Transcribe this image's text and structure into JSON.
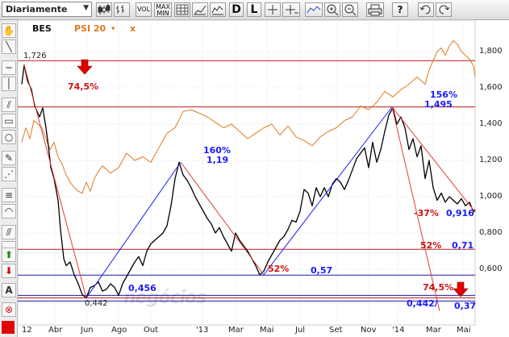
{
  "toolbar": {
    "period": "Diariamente",
    "buttons": [
      "candlestick-icon",
      "bars-icon",
      "line-chart-icon",
      "mountain-icon",
      "VOL",
      "MAX MIN",
      "grid-icon",
      "log-scale-icon",
      "percent-icon",
      "D",
      "L",
      "crosshair-icon",
      "horizontal-line-icon",
      "trend-tool-icon",
      "zoom-in-icon",
      "zoom-out-icon",
      "print-icon",
      "help-icon",
      "undo-icon",
      "redo-icon"
    ],
    "vol_label": "VOL",
    "maxmin_label_top": "MAX",
    "maxmin_label_bottom": "MIN",
    "d_label": "D",
    "l_label": "L",
    "help_label": "?"
  },
  "legend": {
    "main": "BES",
    "compare": "PSI 20",
    "compare_arrow": "▾",
    "close": "x"
  },
  "watermark": "negócios",
  "colors": {
    "bes": "#000000",
    "psi": "#e07a1e",
    "trend_up": "#1a1aff",
    "trend_down": "#e23b3b",
    "level": "#b81c1c",
    "level_blue": "#1a1a9e"
  },
  "chart_data": {
    "type": "line",
    "x_labels": [
      "12",
      "Abr",
      "Jun",
      "Ago",
      "Out",
      "'13",
      "Mar",
      "Mai",
      "Jul",
      "Set",
      "Nov",
      "'14",
      "Mar",
      "Mai"
    ],
    "y_ticks": [
      "1,800",
      "1,600",
      "1,400",
      "1,200",
      "1,000",
      "0,800",
      "0,600"
    ],
    "ylim": [
      0.35,
      1.9
    ],
    "series": [
      {
        "name": "BES",
        "x": [
          0,
          3,
          7,
          12,
          16,
          22,
          26,
          30,
          33,
          36,
          40,
          45,
          48,
          52,
          55,
          60,
          65,
          70,
          75,
          80,
          85,
          90,
          95,
          100,
          105,
          110,
          115,
          120,
          125,
          130,
          135,
          140,
          145,
          150,
          155,
          160,
          165,
          170,
          175,
          180,
          185,
          190,
          195,
          200,
          205,
          210,
          215,
          220,
          225,
          230,
          235,
          240,
          245,
          250,
          255,
          260,
          265,
          270,
          275,
          280,
          285,
          290,
          295,
          300,
          305,
          310,
          315,
          320,
          325,
          330,
          335,
          340,
          345,
          350,
          355,
          360,
          365,
          370,
          375,
          380,
          385,
          390,
          395,
          400,
          405,
          410,
          415,
          420,
          425,
          430,
          435,
          440,
          445,
          450,
          455,
          460,
          465,
          470,
          475,
          480,
          485,
          490,
          495,
          500,
          505,
          510,
          515,
          520,
          525,
          530,
          535,
          540,
          545,
          550,
          555,
          560,
          562
        ],
        "y": [
          1.62,
          1.726,
          1.64,
          1.59,
          1.5,
          1.44,
          1.49,
          1.38,
          1.28,
          1.16,
          1.1,
          0.98,
          0.82,
          0.66,
          0.62,
          0.64,
          0.57,
          0.52,
          0.46,
          0.442,
          0.5,
          0.51,
          0.53,
          0.48,
          0.49,
          0.52,
          0.5,
          0.456,
          0.52,
          0.56,
          0.6,
          0.64,
          0.67,
          0.62,
          0.7,
          0.74,
          0.76,
          0.78,
          0.8,
          0.84,
          0.95,
          1.1,
          1.19,
          1.12,
          1.09,
          1.05,
          1.0,
          0.96,
          0.92,
          0.88,
          0.85,
          0.8,
          0.83,
          0.78,
          0.74,
          0.7,
          0.8,
          0.76,
          0.73,
          0.7,
          0.66,
          0.62,
          0.57,
          0.59,
          0.64,
          0.68,
          0.72,
          0.76,
          0.78,
          0.82,
          0.87,
          0.86,
          0.92,
          1.04,
          1.02,
          0.95,
          1.05,
          1.0,
          1.05,
          1.0,
          1.07,
          1.1,
          1.08,
          1.04,
          1.09,
          1.15,
          1.21,
          1.24,
          1.27,
          1.16,
          1.3,
          1.19,
          1.26,
          1.36,
          1.45,
          1.49,
          1.4,
          1.44,
          1.38,
          1.26,
          1.32,
          1.22,
          1.28,
          1.1,
          1.2,
          1.05,
          0.98,
          1.02,
          0.97,
          1.0,
          0.98,
          0.96,
          0.99,
          0.95,
          0.97,
          0.916,
          0.93
        ]
      },
      {
        "name": "PSI 20",
        "x": [
          0,
          5,
          10,
          15,
          20,
          25,
          30,
          35,
          40,
          45,
          50,
          55,
          60,
          65,
          70,
          75,
          80,
          85,
          90,
          95,
          100,
          110,
          120,
          130,
          140,
          150,
          160,
          170,
          180,
          190,
          200,
          210,
          220,
          230,
          240,
          250,
          260,
          270,
          280,
          290,
          300,
          310,
          320,
          330,
          340,
          350,
          360,
          370,
          380,
          390,
          400,
          410,
          420,
          430,
          440,
          450,
          460,
          470,
          480,
          490,
          500,
          505,
          510,
          515,
          520,
          525,
          530,
          535,
          540,
          545,
          550,
          555,
          560,
          562
        ],
        "y": [
          1.3,
          1.38,
          1.32,
          1.42,
          1.4,
          1.38,
          1.32,
          1.26,
          1.3,
          1.22,
          1.18,
          1.12,
          1.08,
          1.05,
          1.03,
          1.02,
          1.08,
          1.03,
          1.1,
          1.14,
          1.17,
          1.13,
          1.16,
          1.24,
          1.2,
          1.22,
          1.19,
          1.27,
          1.35,
          1.38,
          1.47,
          1.48,
          1.46,
          1.44,
          1.41,
          1.38,
          1.4,
          1.36,
          1.32,
          1.35,
          1.38,
          1.4,
          1.34,
          1.39,
          1.33,
          1.31,
          1.28,
          1.33,
          1.36,
          1.38,
          1.42,
          1.44,
          1.5,
          1.48,
          1.52,
          1.58,
          1.55,
          1.59,
          1.62,
          1.66,
          1.62,
          1.7,
          1.75,
          1.8,
          1.82,
          1.78,
          1.83,
          1.86,
          1.84,
          1.8,
          1.78,
          1.76,
          1.72,
          1.66
        ]
      }
    ],
    "horizontal_levels": [
      {
        "value": 1.75,
        "color": "#b81c1c"
      },
      {
        "value": 1.495,
        "color": "#b81c1c"
      },
      {
        "value": 0.71,
        "color": "#b81c1c"
      },
      {
        "value": 0.568,
        "color": "#1a1a9e"
      },
      {
        "value": 0.456,
        "color": "#1a1a9e"
      },
      {
        "value": 0.442,
        "color": "#b81c1c"
      },
      {
        "value": 0.425,
        "color": "#1a1a9e"
      }
    ],
    "trend_lines": [
      {
        "from": [
          80,
          0.442
        ],
        "to": [
          197,
          1.19
        ],
        "color": "#1a1aff"
      },
      {
        "from": [
          197,
          1.19
        ],
        "to": [
          300,
          0.57
        ],
        "color": "#e23b3b"
      },
      {
        "from": [
          300,
          0.57
        ],
        "to": [
          459,
          1.495
        ],
        "color": "#1a1aff"
      },
      {
        "from": [
          459,
          1.495
        ],
        "to": [
          562,
          0.916
        ],
        "color": "#e23b3b"
      },
      {
        "from": [
          459,
          1.495
        ],
        "to": [
          518,
          0.37
        ],
        "color": "#e23b3b"
      },
      {
        "from": [
          3,
          1.726
        ],
        "to": [
          80,
          0.442
        ],
        "color": "#e23b3b"
      }
    ],
    "annotations": [
      {
        "text": "1,726",
        "color": "#222222"
      },
      {
        "text": "74,5%",
        "color": "#d01010"
      },
      {
        "text": "160%",
        "color": "#1a1aff"
      },
      {
        "text": "1,19",
        "color": "#1a1aff"
      },
      {
        "text": "156%",
        "color": "#1a1aff"
      },
      {
        "text": "1,495",
        "color": "#1a1aff"
      },
      {
        "text": "-37%",
        "color": "#d01010"
      },
      {
        "text": "0,916",
        "color": "#1a1aff"
      },
      {
        "text": "52%",
        "color": "#d01010"
      },
      {
        "text": "0,71",
        "color": "#1a1aff"
      },
      {
        "text": "52%",
        "color": "#d01010"
      },
      {
        "text": "0,57",
        "color": "#1a1aff"
      },
      {
        "text": "0,456",
        "color": "#1a1aff"
      },
      {
        "text": "0,442",
        "color": "#222222"
      },
      {
        "text": "74,5%",
        "color": "#d01010"
      },
      {
        "text": "0,442/",
        "color": "#1a1aff"
      },
      {
        "text": "0,37",
        "color": "#1a1aff"
      }
    ]
  }
}
